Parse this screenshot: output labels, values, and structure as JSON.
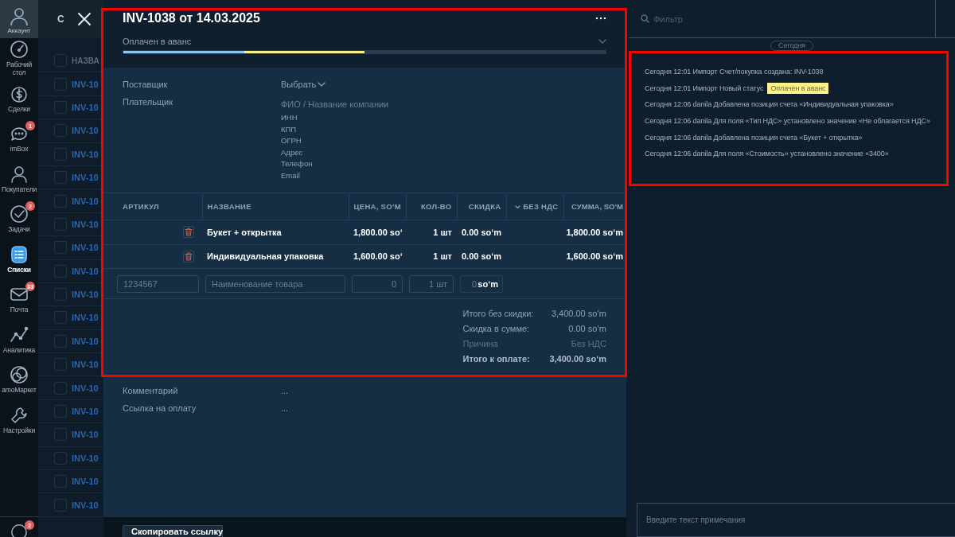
{
  "nav": {
    "account_label": "Аккаунт",
    "items": [
      {
        "label": "Рабочий стол",
        "selected": false
      },
      {
        "label": "Сделки",
        "selected": false
      },
      {
        "label": "imBox",
        "selected": false,
        "badge": "1"
      },
      {
        "label": "Покупатели",
        "selected": false
      },
      {
        "label": "Задачи",
        "selected": false,
        "badge": "2"
      },
      {
        "label": "Списки",
        "selected": true
      },
      {
        "label": "Почта",
        "selected": false,
        "badge": "33"
      },
      {
        "label": "Аналитика",
        "selected": false
      },
      {
        "label": "amoМаркет",
        "selected": false
      },
      {
        "label": "Настройки",
        "selected": false
      }
    ],
    "footer_badge": "2"
  },
  "list": {
    "title": "С",
    "column_header": "НАЗВА",
    "all_checked": false,
    "rows": [
      {
        "name": "INV-10",
        "checked": false
      },
      {
        "name": "INV-10",
        "checked": false
      },
      {
        "name": "INV-10",
        "checked": false
      },
      {
        "name": "INV-10",
        "checked": false
      },
      {
        "name": "INV-10",
        "checked": false
      },
      {
        "name": "INV-10",
        "checked": false
      },
      {
        "name": "INV-10",
        "checked": false
      },
      {
        "name": "INV-10",
        "checked": false
      },
      {
        "name": "INV-10",
        "checked": false
      },
      {
        "name": "INV-10",
        "checked": false
      },
      {
        "name": "INV-10",
        "checked": false
      },
      {
        "name": "INV-10",
        "checked": false
      },
      {
        "name": "INV-10",
        "checked": false
      },
      {
        "name": "INV-10",
        "checked": false
      },
      {
        "name": "INV-10",
        "checked": false
      },
      {
        "name": "INV-10",
        "checked": false
      },
      {
        "name": "INV-10",
        "checked": false
      },
      {
        "name": "INV-10",
        "checked": false
      },
      {
        "name": "INV-10",
        "checked": false
      }
    ]
  },
  "invoice": {
    "title": "INV-1038 от 14.03.2025",
    "status": "Оплачен в аванс",
    "stages": [
      {
        "color": "#8cc6f0"
      },
      {
        "color": "#f4ee8a"
      },
      {
        "color": "#2b3e51"
      },
      {
        "color": "#2b3e51"
      }
    ],
    "supplier": {
      "label": "Поставщик",
      "value": "Выбрать"
    },
    "payer": {
      "label": "Плательщик",
      "placeholder": "ФИО / Название компании",
      "details": [
        "ИНН",
        "КПП",
        "ОГРН",
        "Адрес",
        "Телефон",
        "Email"
      ]
    },
    "table": {
      "columns": [
        "АРТИКУЛ",
        "НАЗВАНИЕ",
        "ЦЕНА, SOʻM",
        "КОЛ-ВО",
        "СКИДКА",
        "БЕЗ НДС",
        "СУММА, SOʻM"
      ],
      "rows": [
        {
          "name": "Букет + открытка",
          "price": "1,800.00 soʻ",
          "qty": "1 шт",
          "discount": "0.00 soʻm",
          "sum": "1,800.00 soʻm"
        },
        {
          "name": "Индивидуальная упаковка",
          "price": "1,600.00 soʻ",
          "qty": "1 шт",
          "discount": "0.00 soʻm",
          "sum": "1,600.00 soʻm"
        }
      ],
      "new_row": {
        "article_placeholder": "1234567",
        "name_placeholder": "Наименование товара",
        "price_placeholder": "0",
        "qty_placeholder": "1 шт",
        "discount_placeholder": "0",
        "discount_unit": "soʻm"
      }
    },
    "totals": [
      {
        "label": "Итого без скидки:",
        "value": "3,400.00 soʻm",
        "kind": "normal"
      },
      {
        "label": "Скидка в сумме:",
        "value": "0.00 soʻm",
        "kind": "normal"
      },
      {
        "label": "Причина",
        "value": "Без НДС",
        "kind": "muted"
      },
      {
        "label": "Итого к оплате:",
        "value": "3,400.00 soʻm",
        "kind": "total"
      }
    ],
    "extra_fields": [
      {
        "label": "Комментарий",
        "value": "..."
      },
      {
        "label": "Ссылка на оплату",
        "value": "..."
      }
    ],
    "copy_button": "Скопировать ссылку"
  },
  "feed": {
    "filter_placeholder": "Фильтр",
    "day_label": "Сегодня",
    "entries": [
      {
        "text": "Сегодня 12:01 Импорт Счет/покупка создана: INV-1038"
      },
      {
        "text": "Сегодня 12:01 Импорт Новый статус",
        "badge": "Оплачен в аванс"
      },
      {
        "text": "Сегодня 12:06 danila Добавлена позиция счета «Индивидуальная упаковка»"
      },
      {
        "text": "Сегодня 12:06 danila Для поля «Тип НДС» установлено значение «Не облагается НДС»"
      },
      {
        "text": "Сегодня 12:06 danila Добавлена позиция счета «Букет + открытка»"
      },
      {
        "text": "Сегодня 12:06 danila Для поля «Стоимость» установлено значение «3400»"
      }
    ],
    "note_placeholder": "Введите текст примечания"
  }
}
